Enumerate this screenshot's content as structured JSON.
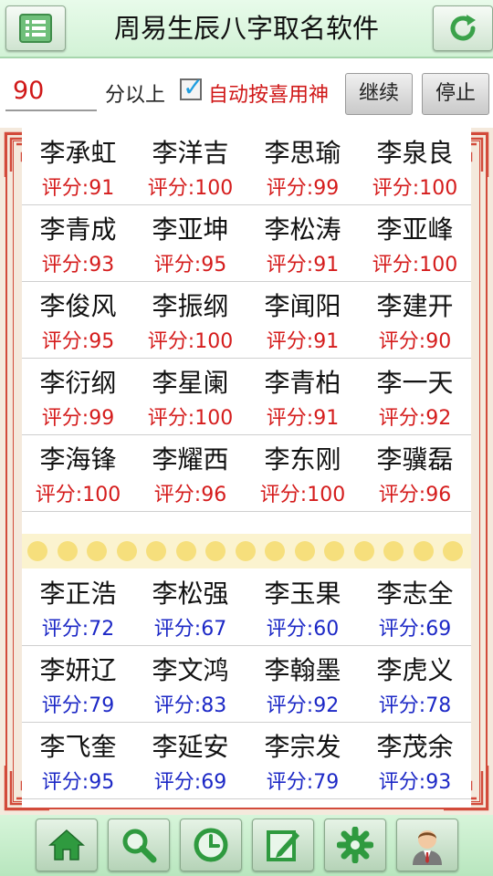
{
  "header": {
    "title": "周易生辰八字取名软件",
    "menu_icon": "list-icon",
    "refresh_icon": "refresh-icon"
  },
  "controls": {
    "score_value": "90",
    "suffix": "分以上",
    "auto_checked": true,
    "auto_label": "自动按喜用神",
    "continue_label": "继续",
    "stop_label": "停止"
  },
  "high_scores": [
    [
      {
        "name": "李承虹",
        "score": "评分:91"
      },
      {
        "name": "李洋吉",
        "score": "评分:100"
      },
      {
        "name": "李思瑜",
        "score": "评分:99"
      },
      {
        "name": "李泉良",
        "score": "评分:100"
      }
    ],
    [
      {
        "name": "李青成",
        "score": "评分:93"
      },
      {
        "name": "李亚坤",
        "score": "评分:95"
      },
      {
        "name": "李松涛",
        "score": "评分:91"
      },
      {
        "name": "李亚峰",
        "score": "评分:100"
      }
    ],
    [
      {
        "name": "李俊风",
        "score": "评分:95"
      },
      {
        "name": "李振纲",
        "score": "评分:100"
      },
      {
        "name": "李闻阳",
        "score": "评分:91"
      },
      {
        "name": "李建开",
        "score": "评分:90"
      }
    ],
    [
      {
        "name": "李衍纲",
        "score": "评分:99"
      },
      {
        "name": "李星阑",
        "score": "评分:100"
      },
      {
        "name": "李青柏",
        "score": "评分:91"
      },
      {
        "name": "李一天",
        "score": "评分:92"
      }
    ],
    [
      {
        "name": "李海锋",
        "score": "评分:100"
      },
      {
        "name": "李耀西",
        "score": "评分:96"
      },
      {
        "name": "李东刚",
        "score": "评分:100"
      },
      {
        "name": "李骥磊",
        "score": "评分:96"
      }
    ]
  ],
  "other_scores": [
    [
      {
        "name": "李正浩",
        "score": "评分:72"
      },
      {
        "name": "李松强",
        "score": "评分:67"
      },
      {
        "name": "李玉果",
        "score": "评分:60"
      },
      {
        "name": "李志全",
        "score": "评分:69"
      }
    ],
    [
      {
        "name": "李妍辽",
        "score": "评分:79"
      },
      {
        "name": "李文鸿",
        "score": "评分:83"
      },
      {
        "name": "李翰墨",
        "score": "评分:92"
      },
      {
        "name": "李虎义",
        "score": "评分:78"
      }
    ],
    [
      {
        "name": "李飞奎",
        "score": "评分:95"
      },
      {
        "name": "李延安",
        "score": "评分:69"
      },
      {
        "name": "李宗发",
        "score": "评分:79"
      },
      {
        "name": "李茂余",
        "score": "评分:93"
      }
    ]
  ],
  "colors": {
    "high_score": "#d51c1c",
    "other_score": "#1c28c6",
    "frame_red": "#d24a3a",
    "divider_dot": "#f6df7c"
  },
  "bottom_nav": [
    {
      "icon": "home-icon"
    },
    {
      "icon": "search-icon"
    },
    {
      "icon": "clock-icon"
    },
    {
      "icon": "edit-icon"
    },
    {
      "icon": "gear-icon"
    },
    {
      "icon": "user-icon"
    }
  ]
}
